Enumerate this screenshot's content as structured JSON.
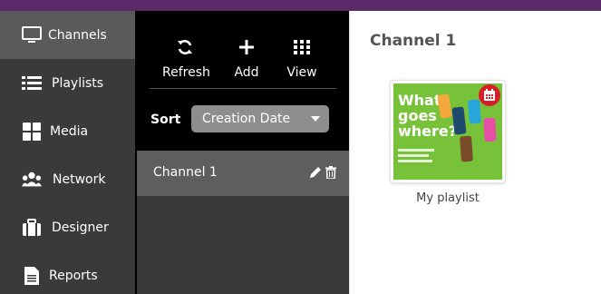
{
  "nav": {
    "items": [
      {
        "label": "Channels",
        "icon": "monitor-icon",
        "active": true
      },
      {
        "label": "Playlists",
        "icon": "list-icon",
        "active": false
      },
      {
        "label": "Media",
        "icon": "grid-icon",
        "active": false
      },
      {
        "label": "Network",
        "icon": "users-icon",
        "active": false
      },
      {
        "label": "Designer",
        "icon": "briefcase-icon",
        "active": false
      },
      {
        "label": "Reports",
        "icon": "document-icon",
        "active": false
      }
    ]
  },
  "toolbar": {
    "refresh_label": "Refresh",
    "add_label": "Add",
    "view_label": "View"
  },
  "sort": {
    "label": "Sort",
    "selected": "Creation Date"
  },
  "channels": [
    {
      "name": "Channel 1"
    }
  ],
  "content": {
    "title": "Channel 1",
    "playlists": [
      {
        "name": "My playlist",
        "thumbnail_text": "What goes where?"
      }
    ]
  },
  "colors": {
    "topbar": "#5b2a68",
    "nav_bg": "#3a3a3a",
    "nav_active": "#5a5a5a",
    "badge": "#d5202a"
  }
}
